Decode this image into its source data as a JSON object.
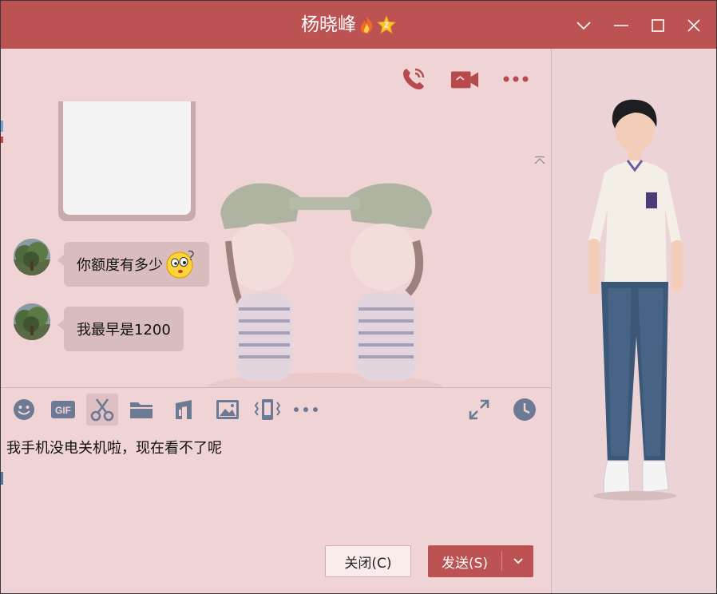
{
  "window": {
    "title": "杨晓峰",
    "controls": [
      "chevron-down-icon",
      "minimize-icon",
      "maximize-icon",
      "close-icon"
    ]
  },
  "top_actions": [
    "phone-call-icon",
    "video-call-icon",
    "more-icon"
  ],
  "messages": [
    {
      "type": "image"
    },
    {
      "type": "text",
      "text": "你额度有多少",
      "emoji": "thinking-emoji"
    },
    {
      "type": "text",
      "text": "我最早是1200"
    }
  ],
  "toolbar": {
    "tools": [
      "emoji-icon",
      "gif-icon",
      "scissors-icon",
      "folder-icon",
      "music-icon",
      "image-icon",
      "shake-icon",
      "more-icon"
    ],
    "right_tools": [
      "expand-icon",
      "history-icon"
    ]
  },
  "input": {
    "value": "我手机没电关机啦，现在看不了呢"
  },
  "buttons": {
    "close_label": "关闭(C)",
    "send_label": "发送(S)"
  },
  "colors": {
    "accent": "#bd5252",
    "background": "#ecd3d5",
    "bubble": "#d8bcbe",
    "icon": "#6c7a93"
  }
}
